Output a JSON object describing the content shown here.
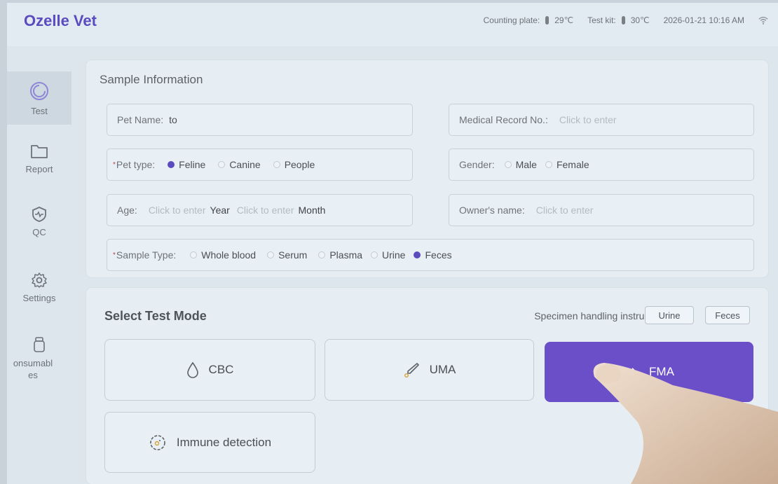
{
  "app": {
    "brand": "Ozelle Vet"
  },
  "status": {
    "counting_plate_label": "Counting plate:",
    "counting_plate_temp": "29℃",
    "test_kit_label": "Test kit:",
    "test_kit_temp": "30℃",
    "datetime": "2026-01-21 10:16 AM"
  },
  "sidebar": {
    "items": [
      {
        "label": "Test",
        "icon": "test-icon"
      },
      {
        "label": "Report",
        "icon": "folder-icon"
      },
      {
        "label": "QC",
        "icon": "shield-icon"
      },
      {
        "label": "Settings",
        "icon": "gear-icon"
      },
      {
        "label": "onsumabl\nes",
        "icon": "bottle-icon"
      }
    ]
  },
  "sample": {
    "title": "Sample Information",
    "pet_name_label": "Pet Name:",
    "pet_name_value": "to",
    "record_label": "Medical Record No.:",
    "record_placeholder": "Click to enter",
    "pet_type_label": "Pet type:",
    "pet_type_options": [
      "Feline",
      "Canine",
      "People"
    ],
    "pet_type_selected": "Feline",
    "gender_label": "Gender:",
    "gender_options": [
      "Male",
      "Female"
    ],
    "age_label": "Age:",
    "age_year_placeholder": "Click to enter",
    "age_year_unit": "Year",
    "age_month_placeholder": "Click to enter",
    "age_month_unit": "Month",
    "owner_label": "Owner's name:",
    "owner_placeholder": "Click to enter",
    "sample_type_label": "Sample Type:",
    "sample_type_options": [
      "Whole blood",
      "Serum",
      "Plasma",
      "Urine",
      "Feces"
    ],
    "sample_type_selected": "Feces"
  },
  "mode": {
    "title": "Select Test Mode",
    "instructions_label": "Specimen handling instructions",
    "urine_button": "Urine",
    "feces_button": "Feces",
    "cbc": "CBC",
    "uma": "UMA",
    "fma": "FMA",
    "immune": "Immune detection"
  },
  "colors": {
    "accent": "#5a4bbf",
    "primary_button": "#6a4fc9",
    "background": "#dde6ed"
  }
}
